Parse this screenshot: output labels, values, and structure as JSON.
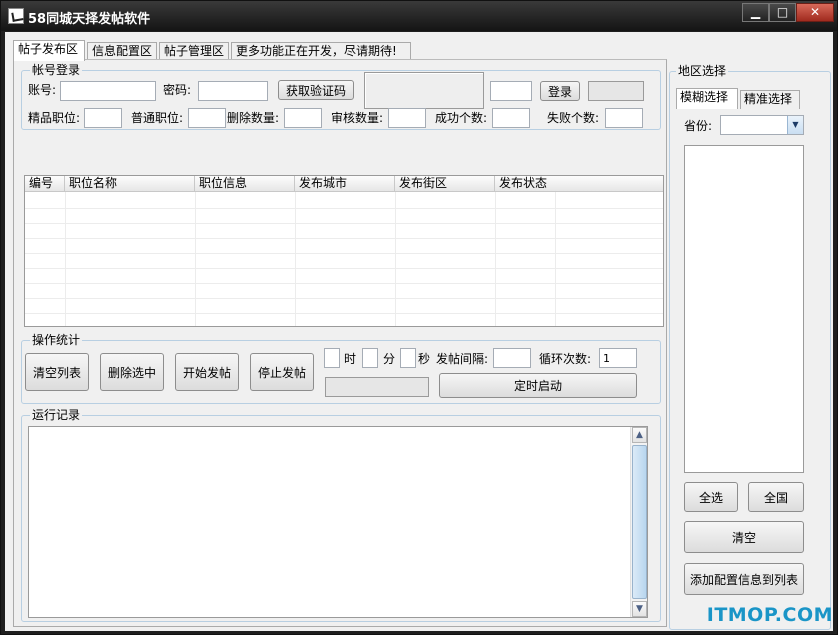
{
  "window": {
    "title": "58同城天择发帖软件",
    "minimize": "▁",
    "maximize": "□",
    "close": "✕"
  },
  "tabs": [
    "帖子发布区",
    "信息配置区",
    "帖子管理区",
    "更多功能正在开发，尽请期待!"
  ],
  "login": {
    "group_label": "帐号登录",
    "account_label": "账号:",
    "account_value": "",
    "password_label": "密码:",
    "password_value": "",
    "captcha_button": "获取验证码",
    "captcha_value": "",
    "login_button": "登录"
  },
  "counts": {
    "premium_label": "精品职位:",
    "premium_value": "",
    "normal_label": "普通职位:",
    "normal_value": "",
    "delete_label": "删除数量:",
    "delete_value": "",
    "review_label": "审核数量:",
    "review_value": "",
    "success_label": "成功个数:",
    "success_value": "",
    "fail_label": "失败个数:",
    "fail_value": ""
  },
  "table": {
    "columns": [
      "编号",
      "职位名称",
      "职位信息",
      "发布城市",
      "发布街区",
      "发布状态"
    ],
    "rows": []
  },
  "ops": {
    "group_label": "操作统计",
    "clear_list": "清空列表",
    "delete_selected": "删除选中",
    "start_post": "开始发帖",
    "stop_post": "停止发帖",
    "hour_label": "时",
    "hour_value": "",
    "minute_label": "分",
    "minute_value": "",
    "second_label": "秒",
    "second_value": "",
    "interval_label": "发帖间隔:",
    "interval_value": "",
    "loop_label": "循环次数:",
    "loop_value": "1",
    "timer_start": "定时启动"
  },
  "log": {
    "group_label": "运行记录",
    "content": ""
  },
  "region": {
    "group_label": "地区选择",
    "tabs": [
      "模糊选择",
      "精准选择"
    ],
    "province_label": "省份:",
    "province_value": "",
    "select_all": "全选",
    "nationwide": "全国",
    "clear": "清空",
    "add_config": "添加配置信息到列表"
  },
  "watermark": "ITMOP.COM"
}
